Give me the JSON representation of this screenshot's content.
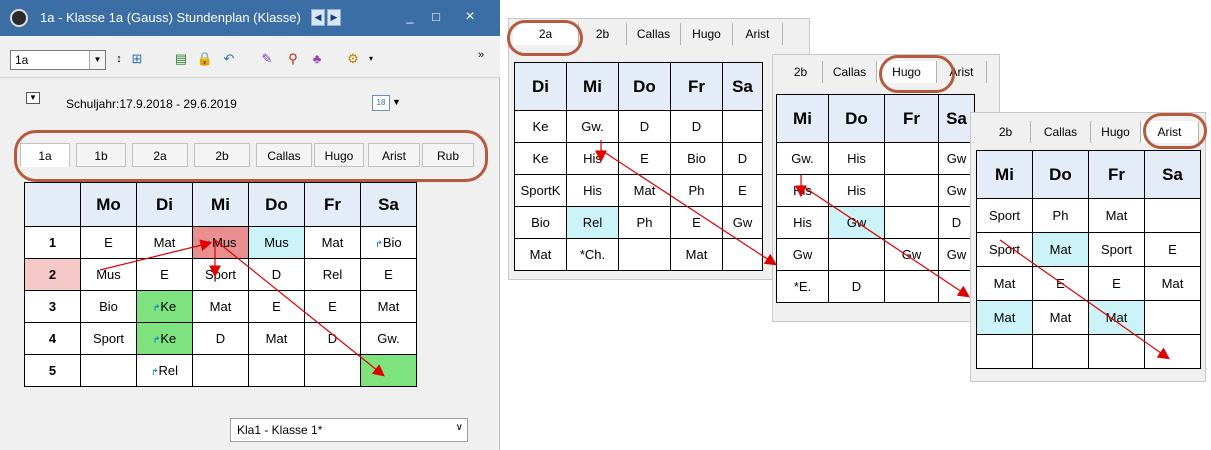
{
  "window": {
    "title": "1a - Klasse 1a (Gauss)  Stundenplan (Klasse)",
    "minimize": "_",
    "maximize": "□",
    "close": "×"
  },
  "toolbar": {
    "class_value": "1a",
    "overflow": "»"
  },
  "info": {
    "schuljahr": "Schuljahr:17.9.2018 - 29.6.2019"
  },
  "tabs": [
    "1a",
    "1b",
    "2a",
    "2b",
    "Callas",
    "Hugo",
    "Arist",
    "Rub"
  ],
  "main_table": {
    "headers": [
      "Mo",
      "Di",
      "Mi",
      "Do",
      "Fr",
      "Sa"
    ],
    "rows": [
      {
        "num": "1",
        "cells": [
          "E",
          "Mat",
          "Mus",
          "Mus",
          "Mat",
          "Bio"
        ]
      },
      {
        "num": "2",
        "cells": [
          "Mus",
          "E",
          "Sport",
          "D",
          "Rel",
          "E"
        ]
      },
      {
        "num": "3",
        "cells": [
          "Bio",
          "Ke",
          "Mat",
          "E",
          "E",
          "Mat"
        ]
      },
      {
        "num": "4",
        "cells": [
          "Sport",
          "Ke",
          "D",
          "Mat",
          "D",
          "Gw."
        ]
      },
      {
        "num": "5",
        "cells": [
          "",
          "Rel",
          "",
          "",
          "",
          ""
        ]
      }
    ]
  },
  "status": {
    "value": "Kla1 - Klasse 1*"
  },
  "panel_2a": {
    "tabs": [
      "2a",
      "2b",
      "Callas",
      "Hugo",
      "Arist"
    ],
    "headers": [
      "Di",
      "Mi",
      "Do",
      "Fr",
      "Sa"
    ],
    "rows": [
      [
        "Ke",
        "Gw.",
        "D",
        "D",
        ""
      ],
      [
        "Ke",
        "His",
        "E",
        "Bio",
        "D"
      ],
      [
        "SportK",
        "His",
        "Mat",
        "Ph",
        "E"
      ],
      [
        "Bio",
        "Rel",
        "Ph",
        "E",
        "Gw"
      ],
      [
        "Mat",
        "*Ch.",
        "",
        "Mat",
        ""
      ]
    ]
  },
  "panel_hugo": {
    "tabs": [
      "2b",
      "Callas",
      "Hugo",
      "Arist"
    ],
    "headers": [
      "Mi",
      "Do",
      "Fr",
      "Sa"
    ],
    "rows": [
      [
        "Gw.",
        "His",
        "",
        "Gw"
      ],
      [
        "His",
        "His",
        "",
        "Gw"
      ],
      [
        "His",
        "Gw",
        "",
        "D"
      ],
      [
        "Gw",
        "",
        "Gw",
        "Gw"
      ],
      [
        "*E.",
        "D",
        "",
        ""
      ]
    ]
  },
  "panel_arist": {
    "tabs": [
      "2b",
      "Callas",
      "Hugo",
      "Arist"
    ],
    "headers": [
      "Mi",
      "Do",
      "Fr",
      "Sa"
    ],
    "rows": [
      [
        "Sport",
        "Ph",
        "Mat",
        ""
      ],
      [
        "Sport",
        "Mat",
        "Sport",
        "E"
      ],
      [
        "Mat",
        "E",
        "E",
        "Mat"
      ],
      [
        "Mat",
        "Mat",
        "Mat",
        ""
      ],
      [
        "",
        "",
        "",
        ""
      ]
    ]
  }
}
